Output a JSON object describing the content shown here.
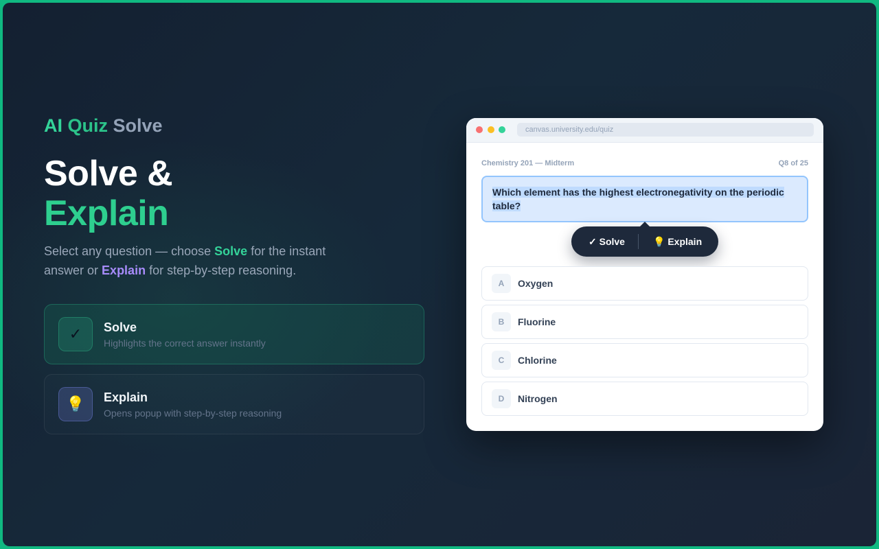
{
  "brand": {
    "ai": "AI",
    "quiz": "Quiz",
    "solve": "Solve"
  },
  "headline": {
    "line1": "Solve &",
    "line2": "Explain"
  },
  "description": {
    "part1": "Select any question — choose ",
    "solve": "Solve",
    "part2": " for the instant answer or ",
    "explain": "Explain",
    "part3": " for step-by-step reasoning."
  },
  "features": [
    {
      "title": "Solve",
      "desc": "Highlights the correct answer instantly",
      "icon": "check-icon",
      "glyph": "✓"
    },
    {
      "title": "Explain",
      "desc": "Opens popup with step-by-step reasoning",
      "icon": "lightbulb-icon",
      "glyph": "💡"
    }
  ],
  "browser": {
    "url": "canvas.university.edu/quiz",
    "course": "Chemistry 201 — Midterm",
    "progress": "Q8 of 25",
    "question": "Which element has the highest electronegativity on the periodic table?",
    "popup": {
      "solve": "✓ Solve",
      "explain": "💡 Explain"
    },
    "options": [
      {
        "letter": "A",
        "text": "Oxygen"
      },
      {
        "letter": "B",
        "text": "Fluorine"
      },
      {
        "letter": "C",
        "text": "Chlorine"
      },
      {
        "letter": "D",
        "text": "Nitrogen"
      }
    ]
  },
  "colors": {
    "accent_green": "#34d399",
    "accent_purple": "#a78bfa",
    "frame_border": "#10b981",
    "background": "#142031"
  }
}
